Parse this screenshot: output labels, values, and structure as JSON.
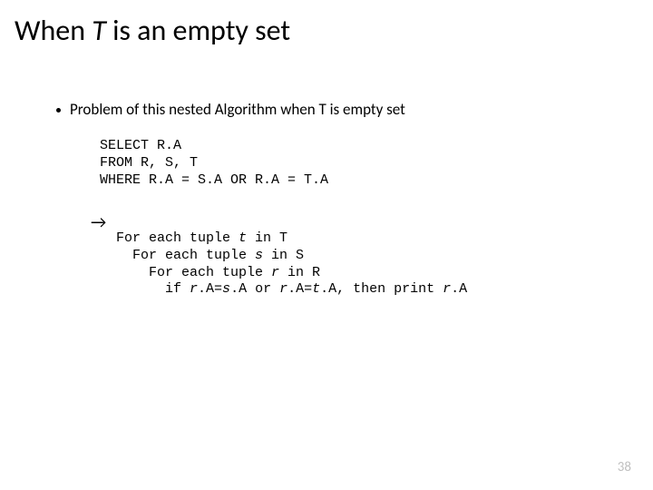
{
  "title": {
    "pre": "When ",
    "var": "T",
    "post": " is an empty set"
  },
  "bullet": "Problem of this nested Algorithm when T is empty set",
  "sql": {
    "l1": "SELECT R.A",
    "l2": "FROM R, S, T",
    "l3": "WHERE R.A = S.A OR R.A = T.A"
  },
  "arrow": "→",
  "algo": {
    "l1a": "For each tuple ",
    "l1v": "t",
    "l1b": " in T",
    "l2a": "  For each tuple ",
    "l2v": "s",
    "l2b": " in S",
    "l3a": "    For each tuple ",
    "l3v": "r",
    "l3b": " in R",
    "l4a": "      if ",
    "l4v1": "r",
    "l4b": ".A=",
    "l4v2": "s",
    "l4c": ".A or ",
    "l4v3": "r",
    "l4d": ".A=",
    "l4v4": "t",
    "l4e": ".A, then print ",
    "l4v5": "r",
    "l4f": ".A"
  },
  "page": "38"
}
